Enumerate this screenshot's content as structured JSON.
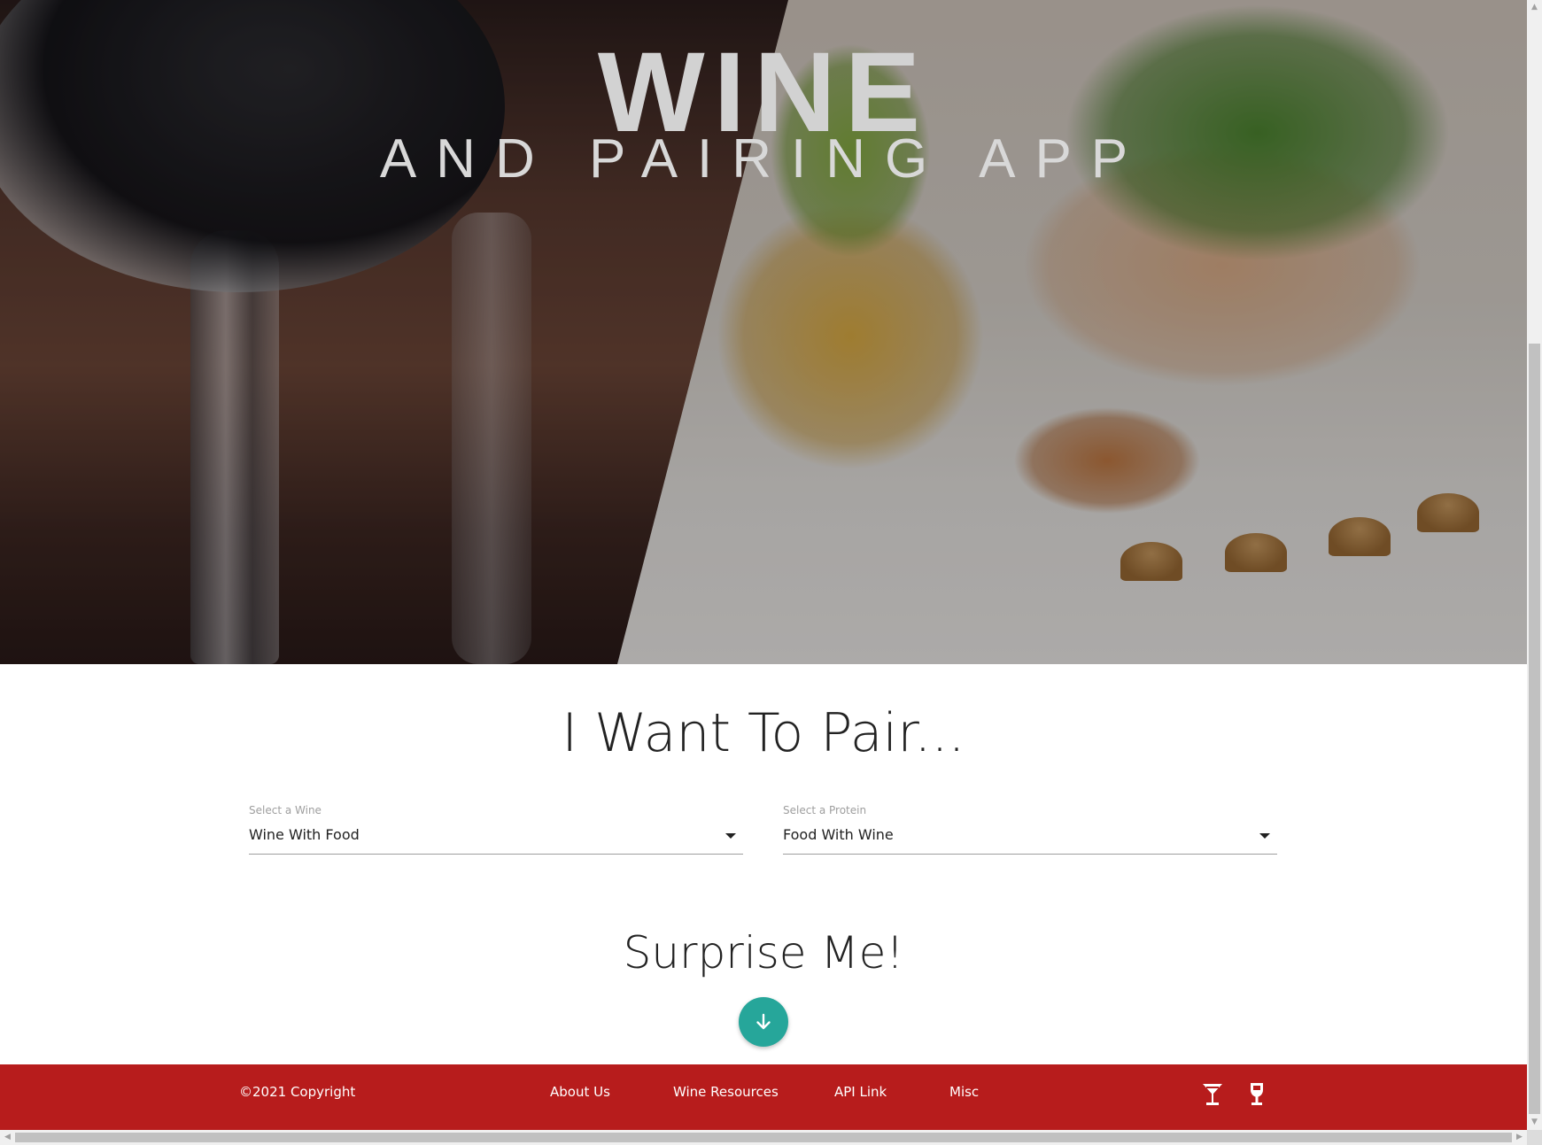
{
  "hero": {
    "title": "WINE",
    "subtitle": "AND PAIRING APP"
  },
  "pair": {
    "heading": "I Want To Pair...",
    "wine_select": {
      "label": "Select a Wine",
      "value": "Wine With Food"
    },
    "protein_select": {
      "label": "Select a Protein",
      "value": "Food With Wine"
    }
  },
  "surprise": {
    "heading": "Surprise Me!",
    "button_icon": "arrow-down-icon"
  },
  "footer": {
    "copyright": "©2021 Copyright",
    "links": [
      "About Us",
      "Wine Resources",
      "API Link",
      "Misc"
    ],
    "icons": [
      "martini-glass-icon",
      "wine-glass-icon"
    ]
  },
  "colors": {
    "footer_bg": "#b71c1c",
    "fab_bg": "#26a69a",
    "text": "#222222"
  }
}
